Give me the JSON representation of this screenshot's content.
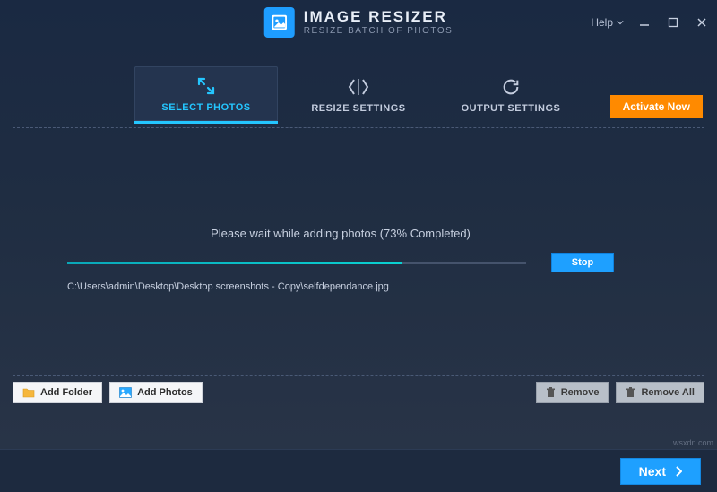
{
  "header": {
    "title": "IMAGE RESIZER",
    "subtitle": "RESIZE BATCH OF PHOTOS",
    "help_label": "Help"
  },
  "tabs": {
    "select": "SELECT PHOTOS",
    "resize": "RESIZE SETTINGS",
    "output": "OUTPUT SETTINGS"
  },
  "activate_label": "Activate Now",
  "progress": {
    "percent": 73,
    "status_text": "Please wait while adding photos (73% Completed)",
    "file_path": "C:\\Users\\admin\\Desktop\\Desktop screenshots - Copy\\selfdependance.jpg",
    "stop_label": "Stop"
  },
  "buttons": {
    "add_folder": "Add Folder",
    "add_photos": "Add Photos",
    "remove": "Remove",
    "remove_all": "Remove All",
    "next": "Next"
  },
  "watermark": "wsxdn.com"
}
